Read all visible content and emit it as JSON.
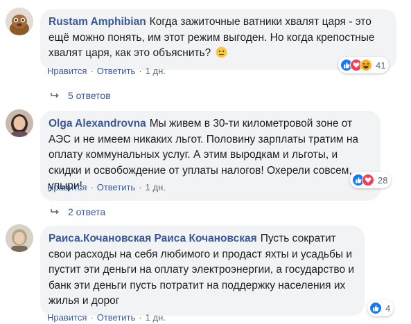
{
  "comments": [
    {
      "author": "Rustam Amphibian",
      "text": "Когда зажиточные ватники хвалят царя - это ещё можно понять, им этот режим выгоден. Но когда крепостные хвалят царя, как это объяснить?",
      "emoji": "neutral-face",
      "like_label": "Нравится",
      "reply_label": "Ответить",
      "time": "1 дн.",
      "reactions": [
        "like",
        "love",
        "haha"
      ],
      "reaction_count": "41",
      "replies_label": "5 ответов"
    },
    {
      "author": "Olga Alexandrovna",
      "text": "Мы живем в 30-ти километровой зоне от АЭС и не имеем никаких льгот. Половину зарплаты тратим на оплату коммунальных услуг. А этим выродкам и льготы, и скидки и освобождение от уплаты налогов! Охерели совсем, упыри!",
      "like_label": "Нравится",
      "reply_label": "Ответить",
      "time": "1 дн.",
      "reactions": [
        "like",
        "love"
      ],
      "reaction_count": "28",
      "replies_label": "2 ответа"
    },
    {
      "author": "Раиса.Кочановская Раиса Кочановская",
      "text": "Пусть сократит свои расходы на себя любимого и продаст яхты и усадьбы и пустит эти деньги на оплату электроэнергии, а государство и банк эти деньги пусть потратит на поддержку населения их жилья и дорог",
      "like_label": "Нравится",
      "reply_label": "Ответить",
      "time": "1 дн.",
      "reactions": [
        "like"
      ],
      "reaction_count": "4"
    }
  ],
  "colors": {
    "author": "#385898",
    "bubble": "#f2f3f5",
    "meta": "#606770",
    "like": "#1877f2",
    "love": "#f33e58",
    "haha": "#f7b125"
  }
}
